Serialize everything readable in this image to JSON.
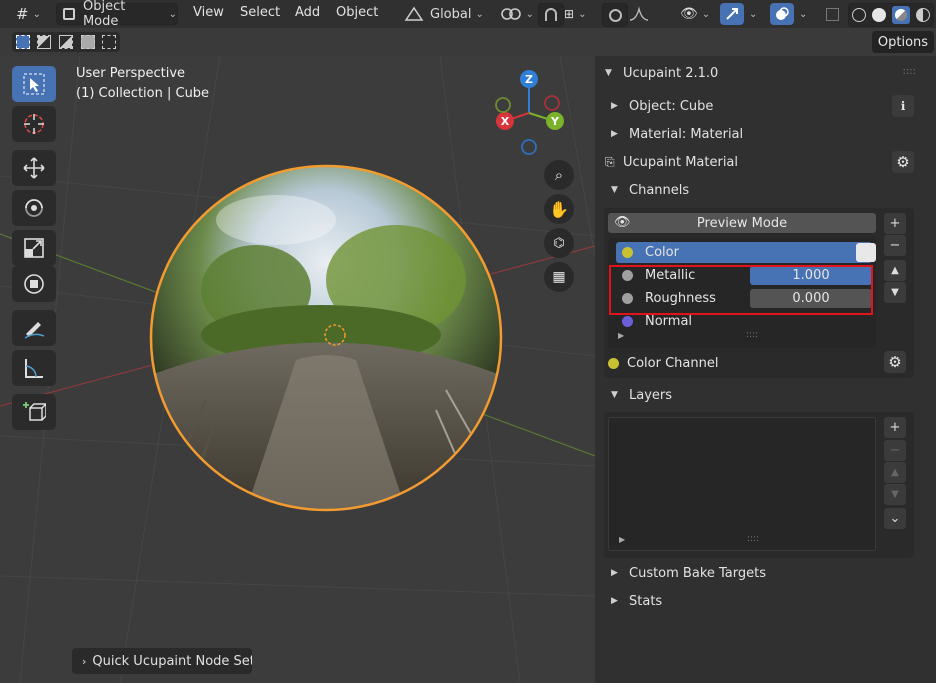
{
  "header": {
    "mode": "Object Mode",
    "menus": [
      "View",
      "Select",
      "Add",
      "Object"
    ],
    "transform_orientation": "Global"
  },
  "row2": {
    "options_label": "Options"
  },
  "viewport": {
    "perspective": "User Perspective",
    "collection": "(1) Collection | Cube",
    "gizmo": {
      "z": "Z",
      "y": "Y",
      "x": "X"
    },
    "popup": "Quick Ucupaint Node Setu"
  },
  "panel": {
    "title": "Ucupaint 2.1.0",
    "object": "Object: Cube",
    "material": "Material: Material",
    "ucupaint_material": "Ucupaint Material",
    "channels_label": "Channels",
    "preview_mode": "Preview Mode",
    "channels": [
      {
        "name": "Color",
        "color": "#c8c232"
      },
      {
        "name": "Metallic",
        "value": "1.000",
        "color": "#a0a0a0"
      },
      {
        "name": "Roughness",
        "value": "0.000",
        "color": "#a0a0a0"
      },
      {
        "name": "Normal",
        "color": "#6b5fd8"
      }
    ],
    "color_channel": "Color Channel",
    "layers_label": "Layers",
    "custom_bake": "Custom Bake Targets",
    "stats": "Stats"
  },
  "colors": {
    "accent": "#4772b3",
    "highlight": "#ff0000",
    "selection": "#f29b31"
  }
}
